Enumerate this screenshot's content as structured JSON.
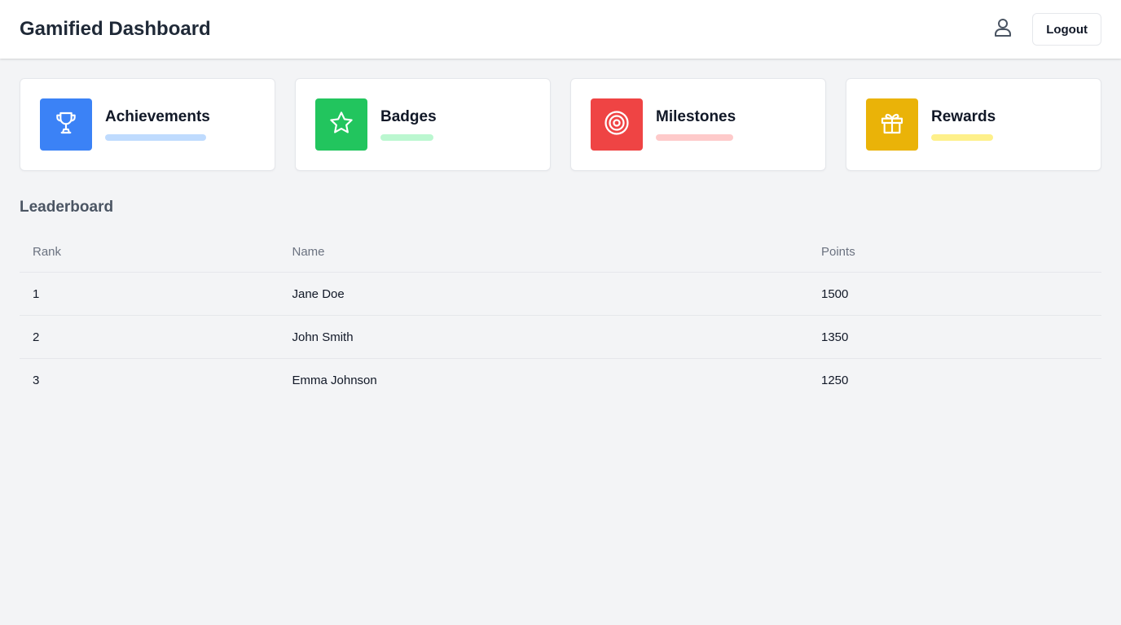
{
  "header": {
    "title": "Gamified Dashboard",
    "user_icon": "user-icon",
    "logout_label": "Logout"
  },
  "cards": [
    {
      "title": "Achievements",
      "icon": "trophy-icon",
      "color": "#3b82f6",
      "bar_color": "#bfdbfe"
    },
    {
      "title": "Badges",
      "icon": "star-icon",
      "color": "#22c55e",
      "bar_color": "#bbf7d0"
    },
    {
      "title": "Milestones",
      "icon": "target-icon",
      "color": "#ef4444",
      "bar_color": "#fecaca"
    },
    {
      "title": "Rewards",
      "icon": "gift-icon",
      "color": "#eab308",
      "bar_color": "#fef08a"
    }
  ],
  "leaderboard": {
    "title": "Leaderboard",
    "columns": [
      "Rank",
      "Name",
      "Points"
    ],
    "rows": [
      {
        "rank": "1",
        "name": "Jane Doe",
        "points": "1500"
      },
      {
        "rank": "2",
        "name": "John Smith",
        "points": "1350"
      },
      {
        "rank": "3",
        "name": "Emma Johnson",
        "points": "1250"
      }
    ]
  }
}
